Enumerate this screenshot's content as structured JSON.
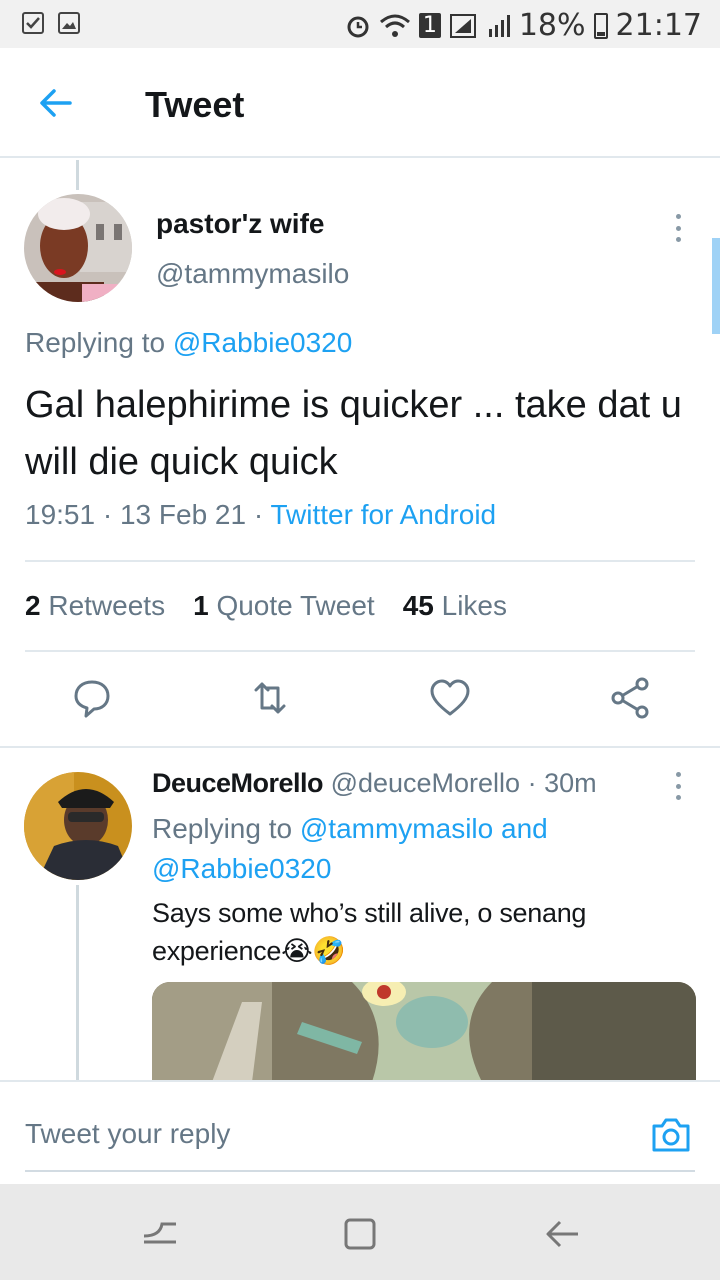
{
  "status_bar": {
    "left_icons": [
      "checkbox-icon",
      "image-icon"
    ],
    "battery": "18%",
    "time": "21:17",
    "sim": "1"
  },
  "header": {
    "title": "Tweet"
  },
  "tweet": {
    "author_name": "pastor'z wife",
    "author_handle": "@tammymasilo",
    "replying_label": "Replying to",
    "replying_to": "@Rabbie0320",
    "text": "Gal halephirime is quicker ... take dat u will die quick  quick",
    "time": "19:51",
    "date": "13 Feb 21",
    "source": "Twitter for Android",
    "stats": {
      "retweets_count": "2",
      "retweets_label": "Retweets",
      "quotes_count": "1",
      "quotes_label": "Quote Tweet",
      "likes_count": "45",
      "likes_label": "Likes"
    },
    "actions": [
      "reply-icon",
      "retweet-icon",
      "like-icon",
      "share-icon"
    ]
  },
  "reply": {
    "author_name": "DeuceMorello",
    "author_handle": "@deuceMorello",
    "age": "30m",
    "replying_label": "Replying to",
    "replying_to_1": "@tammymasilo",
    "replying_and": "and",
    "replying_to_2": "@Rabbie0320",
    "text": "Says some who’s still alive, o senang experience😭🤣"
  },
  "compose": {
    "placeholder": "Tweet your reply"
  },
  "colors": {
    "accent": "#1da1f2",
    "secondary_text": "#657786",
    "primary_text": "#14171a"
  }
}
